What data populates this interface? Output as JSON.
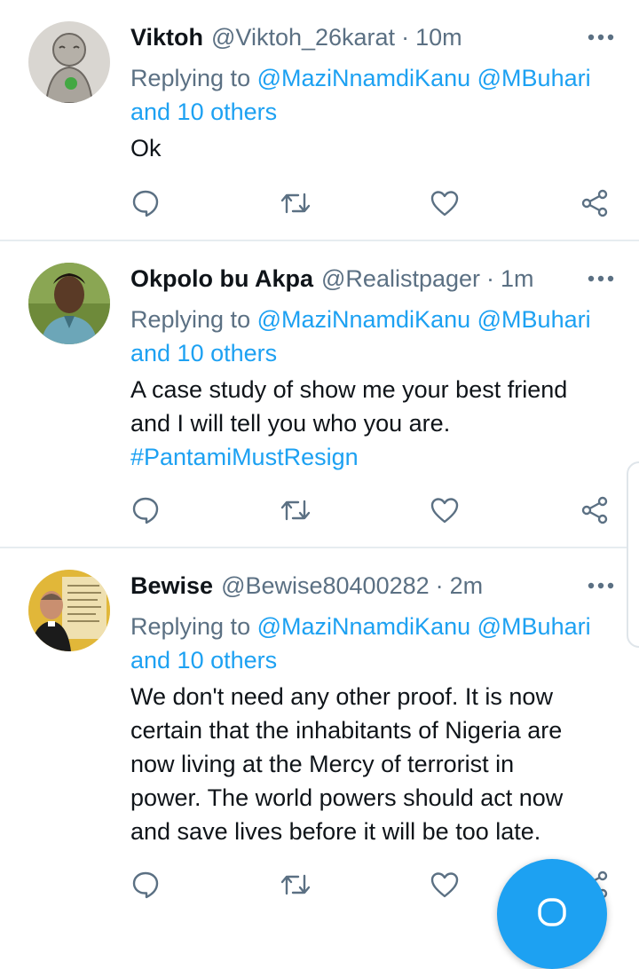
{
  "tweets": [
    {
      "name": "Viktoh",
      "handle": "@Viktoh_26karat",
      "separator": "·",
      "time": "10m",
      "replying_prefix": "Replying to",
      "mention1": "@MaziNnamdiKanu",
      "mention2": "@MBuhari",
      "others": "and 10 others",
      "lines": [
        "Ok"
      ],
      "avatar": "avatar-sketch-figure"
    },
    {
      "name": "Okpolo bu Akpa",
      "handle": "@Realistpager",
      "separator": "·",
      "time": "1m",
      "replying_prefix": "Replying to",
      "mention1": "@MaziNnamdiKanu",
      "mention2": "@MBuhari",
      "others": "and 10 others",
      "lines": [
        "A case study of show me your best friend",
        "and I will tell you who you are."
      ],
      "hashtag": "#PantamiMustResign",
      "avatar": "avatar-young-man"
    },
    {
      "name": "Bewise",
      "handle": "@Bewise80400282",
      "separator": "·",
      "time": "2m",
      "replying_prefix": "Replying to",
      "mention1": "@MaziNnamdiKanu",
      "mention2": "@MBuhari",
      "others": "and 10 others",
      "lines": [
        "We don't need any other proof. It is now",
        "certain that the inhabitants of Nigeria are",
        "now living at the Mercy of terrorist in",
        "power. The world powers should act now",
        "and save lives before it will be too late."
      ],
      "avatar": "avatar-priest-quote"
    }
  ],
  "icons": {
    "reply": "reply-icon",
    "retweet": "retweet-icon",
    "like": "like-icon",
    "share": "share-icon",
    "more": "more-icon",
    "compose": "compose-icon"
  },
  "colors": {
    "accent": "#1da1f2",
    "secondary_text": "#5b7083",
    "primary_text": "#0f1419",
    "divider": "#e6ecf0"
  }
}
